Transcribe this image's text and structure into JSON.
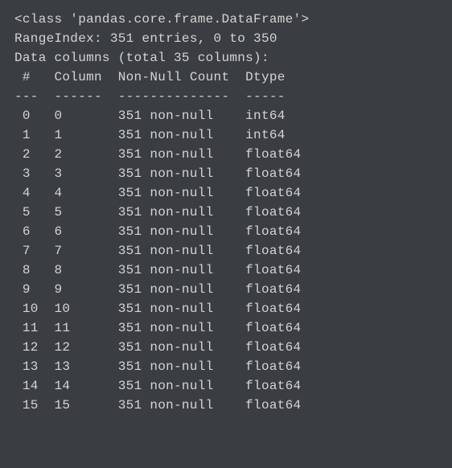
{
  "header": {
    "class_line": "<class 'pandas.core.frame.DataFrame'>",
    "range_index": "RangeIndex: 351 entries, 0 to 350",
    "columns_total": "Data columns (total 35 columns):"
  },
  "table_header": {
    "num_col": " #   Column  Non-Null Count  Dtype  ",
    "separator": "---  ------  --------------  -----  "
  },
  "rows": [
    {
      "line": " 0   0       351 non-null    int64  "
    },
    {
      "line": " 1   1       351 non-null    int64  "
    },
    {
      "line": " 2   2       351 non-null    float64"
    },
    {
      "line": " 3   3       351 non-null    float64"
    },
    {
      "line": " 4   4       351 non-null    float64"
    },
    {
      "line": " 5   5       351 non-null    float64"
    },
    {
      "line": " 6   6       351 non-null    float64"
    },
    {
      "line": " 7   7       351 non-null    float64"
    },
    {
      "line": " 8   8       351 non-null    float64"
    },
    {
      "line": " 9   9       351 non-null    float64"
    },
    {
      "line": " 10  10      351 non-null    float64"
    },
    {
      "line": " 11  11      351 non-null    float64"
    },
    {
      "line": " 12  12      351 non-null    float64"
    },
    {
      "line": " 13  13      351 non-null    float64"
    },
    {
      "line": " 14  14      351 non-null    float64"
    },
    {
      "line": " 15  15      351 non-null    float64"
    }
  ]
}
